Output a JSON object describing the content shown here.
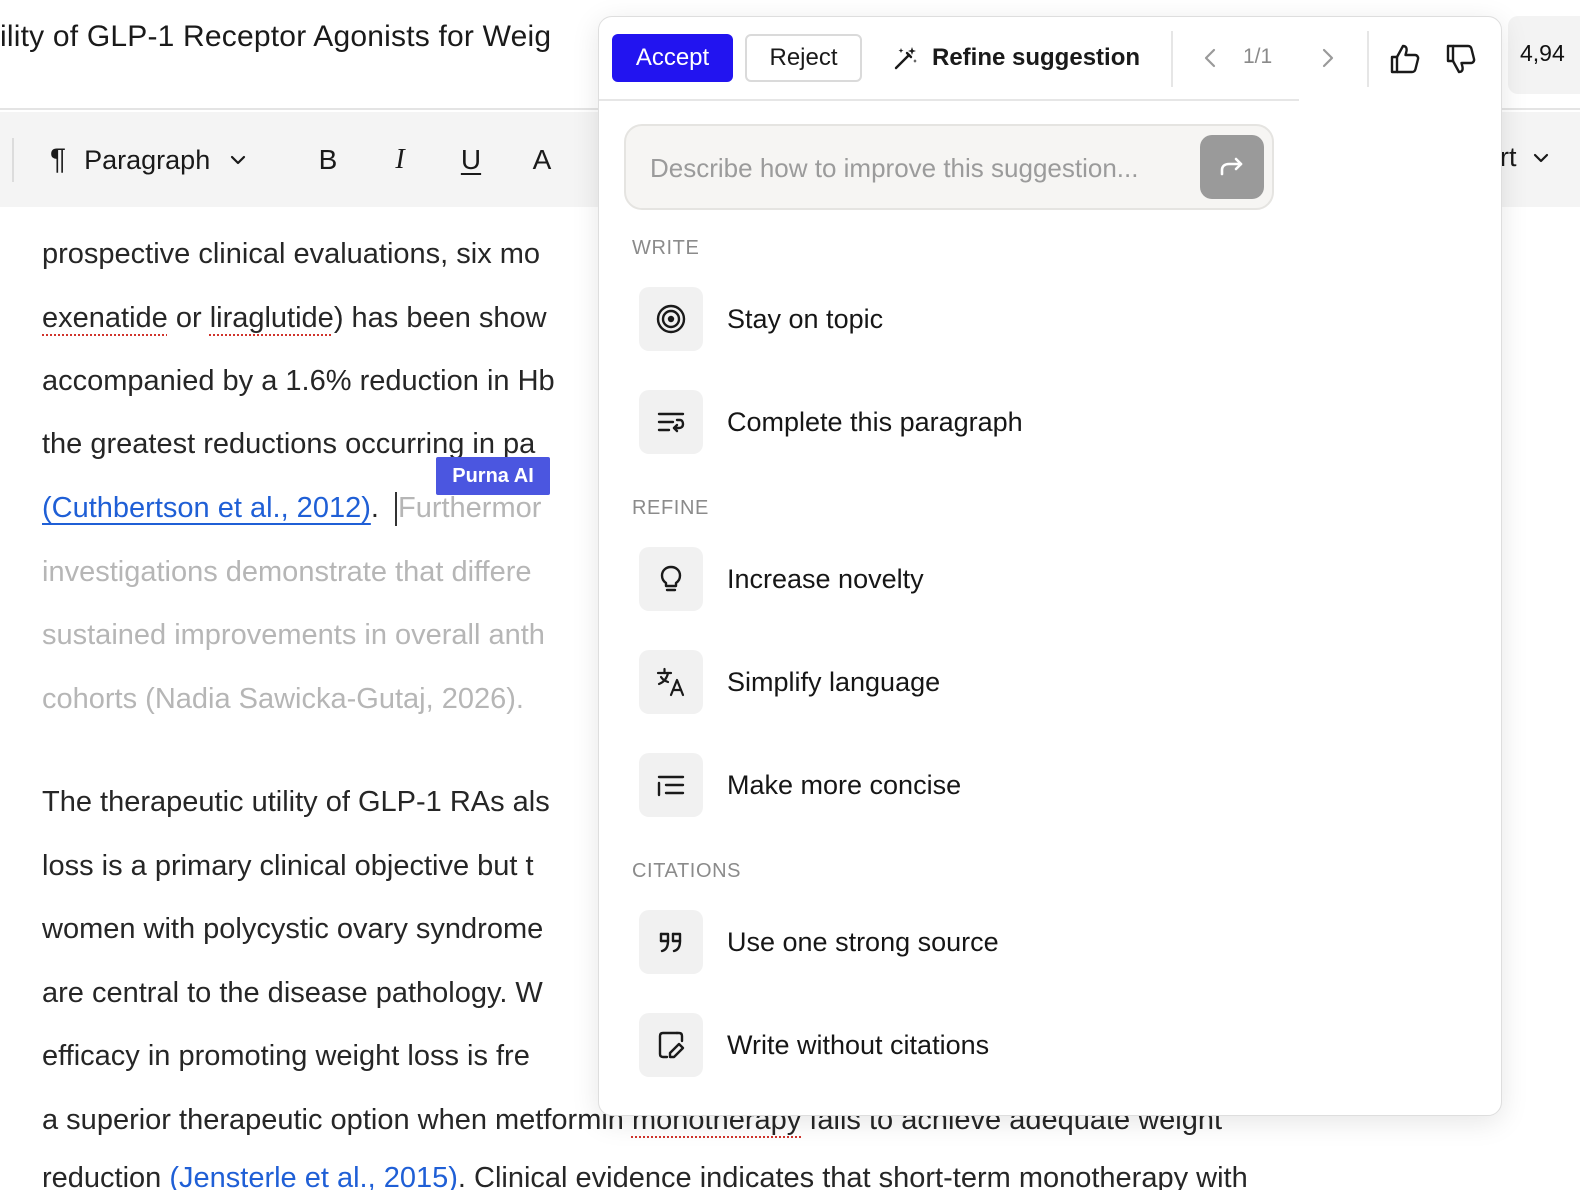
{
  "header": {
    "title": "ility of GLP-1 Receptor Agonists for Weig",
    "word_count": "4,94"
  },
  "toolbar": {
    "paragraph_label": "Paragraph",
    "bold": "B",
    "italic": "I",
    "underline": "U",
    "text_color": "A",
    "right_label": "rt"
  },
  "document": {
    "lines": [
      [
        "prospective clinical evaluations, six mo"
      ],
      [
        "exenatide",
        " or ",
        "liraglutide",
        ") has been show"
      ],
      [
        "accompanied by a 1.6% reduction in Hb"
      ],
      [
        "the greatest reductions occurring in pa"
      ],
      [
        "(Cuthbertson et al., 2012)",
        ". ",
        "Furthermor"
      ],
      [
        "investigations demonstrate that differe"
      ],
      [
        "sustained improvements in overall anth"
      ],
      [
        "cohorts (Nadia Sawicka-Gutaj, 2026)."
      ],
      [
        "The therapeutic utility of GLP-1 RAs als"
      ],
      [
        "loss is a primary clinical objective but t"
      ],
      [
        "women with polycystic ovary syndrome"
      ],
      [
        "are central to the disease pathology. W"
      ],
      [
        "efficacy in promoting weight loss is fre"
      ],
      [
        "a superior therapeutic option when metformin ",
        "monotherapy",
        " fails to achieve adequate weight"
      ],
      [
        "reduction ",
        "(Jensterle et al., 2015)",
        ". Clinical evidence indicates that short-term monotherapy with"
      ]
    ],
    "ai_tag": "Purna AI"
  },
  "popup": {
    "accept_label": "Accept",
    "reject_label": "Reject",
    "refine_label": "Refine suggestion",
    "counter": "1/1",
    "refine_placeholder": "Describe how to improve this suggestion...",
    "sections": {
      "write": "WRITE",
      "refine": "REFINE",
      "citations": "CITATIONS"
    },
    "options": {
      "stay_on_topic": "Stay on topic",
      "complete_paragraph": "Complete this paragraph",
      "increase_novelty": "Increase novelty",
      "simplify_language": "Simplify language",
      "make_concise": "Make more concise",
      "one_source": "Use one strong source",
      "no_citations": "Write without citations"
    }
  },
  "colors": {
    "accent": "#2214f0",
    "ai_tag": "#4b56e0",
    "citation_link": "#1f5fd6",
    "ghost_text": "#b6b6b6"
  },
  "icons": {
    "paragraph": "pilcrow-icon",
    "refine": "magic-wand-icon",
    "prev": "chevron-left-icon",
    "next": "chevron-right-icon",
    "like": "thumbs-up-icon",
    "dislike": "thumbs-down-icon",
    "send": "forward-arrow-icon",
    "stay_on_topic": "target-icon",
    "complete_paragraph": "text-wrap-icon",
    "increase_novelty": "lightbulb-icon",
    "simplify_language": "translate-icon",
    "make_concise": "list-indent-icon",
    "one_source": "quote-icon",
    "no_citations": "document-edit-icon"
  }
}
